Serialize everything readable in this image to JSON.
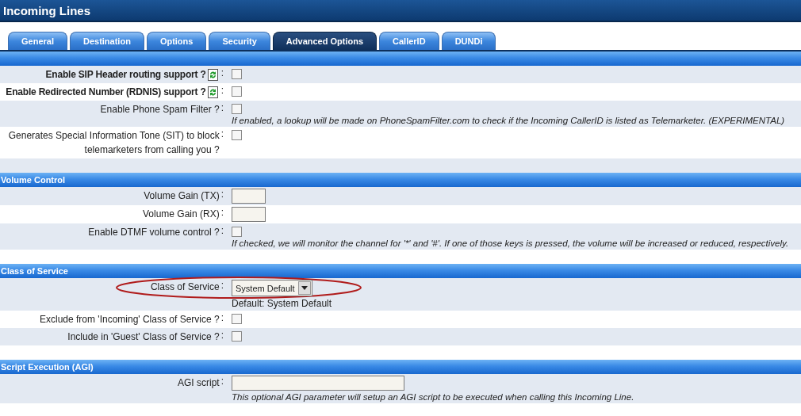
{
  "window": {
    "title": "Incoming Lines"
  },
  "tabs": [
    {
      "label": "General",
      "selected": false
    },
    {
      "label": "Destination",
      "selected": false
    },
    {
      "label": "Options",
      "selected": false
    },
    {
      "label": "Security",
      "selected": false
    },
    {
      "label": "Advanced Options",
      "selected": true
    },
    {
      "label": "CallerID",
      "selected": false
    },
    {
      "label": "DUNDi",
      "selected": false
    }
  ],
  "label_separator": ":",
  "sections": [
    {
      "rows": [
        {
          "kind": "checkbox",
          "label": "Enable SIP Header routing support ?",
          "bold": true,
          "help": true,
          "checked": false
        },
        {
          "kind": "checkbox",
          "label": "Enable Redirected Number (RDNIS) support ?",
          "bold": true,
          "help": true,
          "checked": false
        },
        {
          "kind": "checkbox",
          "label": "Enable Phone Spam Filter ?",
          "checked": false,
          "hint": "If enabled, a lookup will be made on PhoneSpamFilter.com to check if the Incoming CallerID is listed as Telemarketer. (EXPERIMENTAL)"
        },
        {
          "kind": "checkbox",
          "label": "Generates Special Information Tone (SIT) to block telemarketers from calling you ?",
          "checked": false
        }
      ]
    },
    {
      "title": "Volume Control",
      "rows": [
        {
          "kind": "text",
          "label": "Volume Gain (TX)"
        },
        {
          "kind": "text",
          "label": "Volume Gain (RX)"
        },
        {
          "kind": "checkbox",
          "label": "Enable DTMF volume control ?",
          "checked": false,
          "hint": "If checked, we will monitor the channel for '*' and '#'. If one of those keys is pressed, the volume will be increased or reduced, respectively."
        }
      ]
    },
    {
      "title": "Class of Service",
      "rows": [
        {
          "kind": "select",
          "label": "Class of Service",
          "value": "System Default",
          "note": "Default: System Default",
          "circled": true
        },
        {
          "kind": "checkbox",
          "label": "Exclude from 'Incoming' Class of Service ?",
          "checked": false
        },
        {
          "kind": "checkbox",
          "label": "Include in 'Guest' Class of Service ?",
          "checked": false
        }
      ]
    },
    {
      "title": "Script Execution (AGI)",
      "rows": [
        {
          "kind": "wide_text",
          "label": "AGI script",
          "hint": "This optional AGI parameter will setup an AGI script to be executed when calling this Incoming Line."
        }
      ]
    }
  ]
}
